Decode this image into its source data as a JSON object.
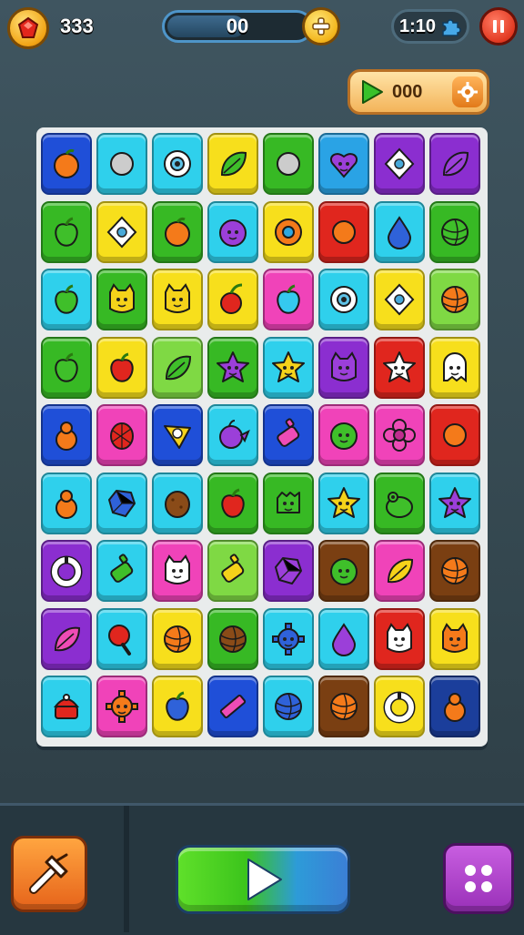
{
  "hud": {
    "coins": "333",
    "progress_text": "00",
    "progress_fraction": 0.55,
    "lives_text": "1:10",
    "reward_text": "000"
  },
  "icons": {
    "gem": "gem-icon",
    "plus": "plus-icon",
    "puzzle": "puzzle-piece-icon",
    "pause": "pause-icon",
    "video_play": "play-icon",
    "gear": "gear-icon",
    "hammer": "hammer-tool-icon",
    "play": "play-icon",
    "menu": "grid-menu-icon"
  },
  "colors": {
    "blue": "#1f4fd8",
    "cyan": "#2fd0ec",
    "yellow": "#f7df1c",
    "green": "#37b924",
    "lime": "#7fd944",
    "red": "#e0261e",
    "pink": "#f043b9",
    "purple": "#8b2ed0",
    "brown": "#7a3f12",
    "navy": "#1b3e9b",
    "sky": "#2aa3e5"
  },
  "board": {
    "rows": [
      [
        [
          "blue",
          "orange-fruit"
        ],
        [
          "cyan",
          "walnut"
        ],
        [
          "cyan",
          "white-eye"
        ],
        [
          "yellow",
          "green-leaf"
        ],
        [
          "green",
          "leaf-swirl"
        ],
        [
          "sky",
          "purple-heart"
        ],
        [
          "purple",
          "white-diamond"
        ],
        [
          "purple",
          "purple-leaf"
        ]
      ],
      [
        [
          "green",
          "green-apple"
        ],
        [
          "yellow",
          "white-diamond"
        ],
        [
          "green",
          "orange-fruit"
        ],
        [
          "cyan",
          "purple-blob"
        ],
        [
          "yellow",
          "orange-donut"
        ],
        [
          "red",
          "orange-fox"
        ],
        [
          "cyan",
          "blue-drop"
        ],
        [
          "green",
          "green-ball"
        ]
      ],
      [
        [
          "cyan",
          "green-apple"
        ],
        [
          "green",
          "yellow-cat"
        ],
        [
          "yellow",
          "yellow-cat"
        ],
        [
          "yellow",
          "red-cherry"
        ],
        [
          "pink",
          "cyan-apple"
        ],
        [
          "cyan",
          "white-eye"
        ],
        [
          "yellow",
          "white-diamond"
        ],
        [
          "lime",
          "orange-ball"
        ]
      ],
      [
        [
          "green",
          "green-apple"
        ],
        [
          "yellow",
          "red-apple"
        ],
        [
          "lime",
          "green-leaf"
        ],
        [
          "green",
          "purple-star"
        ],
        [
          "cyan",
          "yellow-star"
        ],
        [
          "purple",
          "purple-cat"
        ],
        [
          "red",
          "white-star"
        ],
        [
          "yellow",
          "white-ghost"
        ]
      ],
      [
        [
          "blue",
          "orange-gourd"
        ],
        [
          "pink",
          "red-berry"
        ],
        [
          "blue",
          "yellow-triangle"
        ],
        [
          "cyan",
          "purple-bird"
        ],
        [
          "blue",
          "pink-bottle"
        ],
        [
          "pink",
          "green-blob"
        ],
        [
          "pink",
          "pink-flower"
        ],
        [
          "red",
          "orange-fox"
        ]
      ],
      [
        [
          "cyan",
          "orange-gourd"
        ],
        [
          "cyan",
          "blue-gem"
        ],
        [
          "cyan",
          "brown-potato"
        ],
        [
          "green",
          "red-apple"
        ],
        [
          "green",
          "green-monster"
        ],
        [
          "cyan",
          "yellow-star"
        ],
        [
          "green",
          "green-frog"
        ],
        [
          "cyan",
          "purple-star"
        ]
      ],
      [
        [
          "purple",
          "white-ring"
        ],
        [
          "cyan",
          "green-bottle"
        ],
        [
          "pink",
          "white-cat"
        ],
        [
          "lime",
          "yellow-bottle"
        ],
        [
          "purple",
          "purple-gem"
        ],
        [
          "brown",
          "green-blob"
        ],
        [
          "pink",
          "yellow-leaf"
        ],
        [
          "brown",
          "orange-ball"
        ]
      ],
      [
        [
          "purple",
          "pink-leaf"
        ],
        [
          "cyan",
          "red-lollipop"
        ],
        [
          "yellow",
          "orange-ball"
        ],
        [
          "green",
          "brown-ball"
        ],
        [
          "cyan",
          "blue-gear"
        ],
        [
          "cyan",
          "purple-drop"
        ],
        [
          "red",
          "white-cat"
        ],
        [
          "yellow",
          "orange-cat"
        ]
      ],
      [
        [
          "cyan",
          "red-cake"
        ],
        [
          "pink",
          "orange-gear"
        ],
        [
          "yellow",
          "blue-apple"
        ],
        [
          "blue",
          "pink-bar"
        ],
        [
          "cyan",
          "blue-ball"
        ],
        [
          "brown",
          "orange-ball"
        ],
        [
          "yellow",
          "white-ring"
        ],
        [
          "navy",
          "orange-gourd"
        ]
      ]
    ]
  }
}
